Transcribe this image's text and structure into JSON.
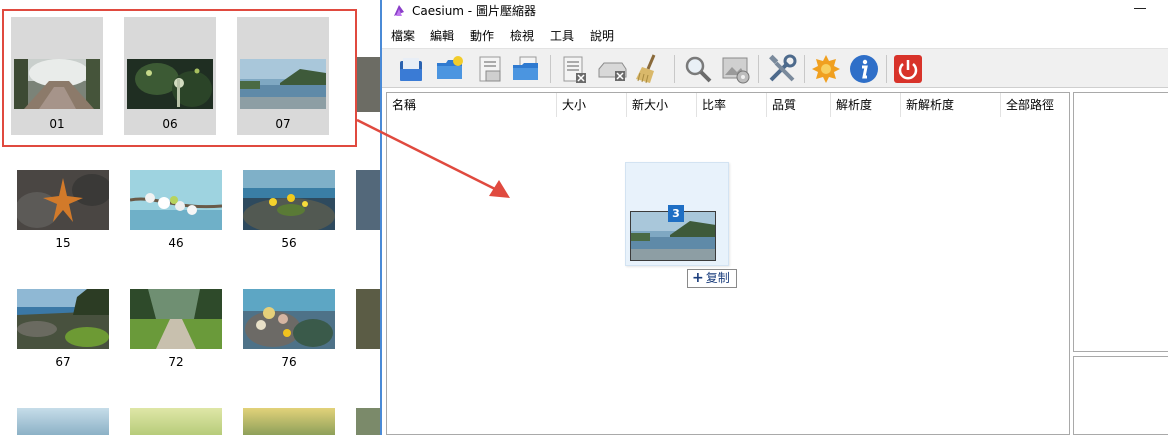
{
  "app": {
    "title": "Caesium - 圖片壓縮器",
    "menu": [
      "檔案",
      "編輯",
      "動作",
      "檢視",
      "工具",
      "說明"
    ]
  },
  "explorer": {
    "selected": [
      "01",
      "06",
      "07"
    ],
    "rows": [
      [
        "15",
        "46",
        "56"
      ],
      [
        "67",
        "72",
        "76"
      ]
    ]
  },
  "filelist": {
    "columns": [
      "名稱",
      "大小",
      "新大小",
      "比率",
      "品質",
      "解析度",
      "新解析度",
      "全部路徑"
    ]
  },
  "drag": {
    "count": "3",
    "action": "复制"
  },
  "toolbar": {
    "icons": [
      "add-file-icon",
      "add-folder-icon",
      "save-list-icon",
      "open-list-icon",
      "remove-item-icon",
      "clear-list-icon",
      "clean-icon",
      "preview-icon",
      "image-settings-icon",
      "settings-icon",
      "compress-icon",
      "info-icon",
      "exit-icon"
    ]
  },
  "colors": {
    "highlight_red": "#e04a3f",
    "accent_blue": "#1f6fc4"
  }
}
